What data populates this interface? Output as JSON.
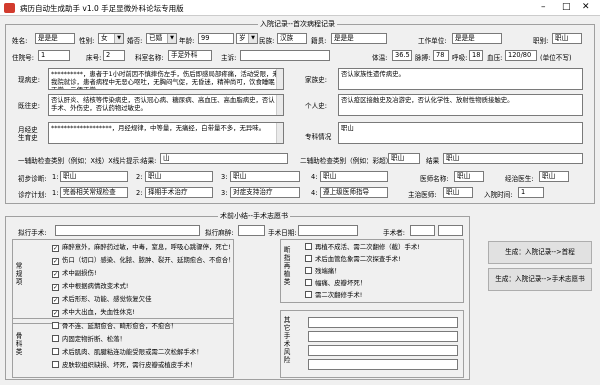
{
  "window": {
    "title": "病历自动生成助手 v1.0 手足显微外科论坛专用版",
    "min": "–",
    "max": "□",
    "close": "✕"
  },
  "group1_title": "入院记录--首次病程记录",
  "row1": {
    "name_label": "姓名:",
    "name_value": "是是是",
    "sex_label": "性别:",
    "sex_value": "女",
    "marital_label": "婚否:",
    "marital_value": "已婚",
    "age_label": "年龄:",
    "age_value": "99",
    "age_unit_label": "岁",
    "age_unit_value": "岁",
    "nation_label": "民族:",
    "nation_value": "汉族",
    "origin_label": "籍贯:",
    "origin_value": "是是是",
    "work_label": "工作单位:",
    "work_value": "是是是",
    "job_label": "职别:",
    "job_value": "职山"
  },
  "row2": {
    "bed_label": "住院号:",
    "bed_value": "1",
    "bedno_label": "床号:",
    "bedno_value": "2",
    "dept_label": "科室名称:",
    "dept_value": "手足外科",
    "chief_label": "主诉:",
    "temp_label": "体温:",
    "temp_value": "36.5",
    "pulse_label": "脉搏:",
    "pulse_value": "78",
    "resp_label": "呼吸:",
    "resp_value": "18",
    "bp_label": "血压:",
    "bp_value": "120/80",
    "bp_unit": "(单位不写)"
  },
  "history": {
    "present_label": "现病史:",
    "present_value": "**********，患者于1小时前因不慎摔伤左手，伤后即感局部疼痛，活动受限，来我院就诊，患者病程中无恶心呕吐，无胸闷气促，无昏迷，精神尚可，饮食睡眠正常，二便正常。",
    "family_label": "家族史:",
    "family_value": "否认家族性遗传病史。",
    "past_label": "既往史:",
    "past_value": "否认肝炎、结核等传染病史，否认冠心病、糖尿病、高血压、高血脂病史，否认手术、外伤史，否认药物过敏史。",
    "personal_label": "个人史:",
    "personal_value": "否认疫区接触史及冶游史，否认化学性、放射性物质接触史。",
    "exam_label": "月经史\n生育史",
    "exam_value": "*******************，月经规律，中等量，无痛经，白带量不多，无异味。",
    "special_label": "专科情况",
    "special_value": "职山"
  },
  "aux": {
    "first_label": "一辅助检查类别（例如：X线）X线片提示:",
    "first_value": "结果:",
    "first_result": "山",
    "second_label": "二辅助检查类别（例如：彩超）",
    "second_value": "职山",
    "second_result_label": "结果",
    "second_result": "职山"
  },
  "diag": {
    "init_label": "初步诊断:",
    "d1": "1:",
    "d1v": "职山",
    "d2": "2:",
    "d2v": "职山",
    "d3": "3:",
    "d3v": "职山",
    "d4": "4:",
    "d4v": "职山",
    "doctor_label": "医师名称:",
    "doctor_value": "职山",
    "attending_label": "经治医生:",
    "attending_value": "职山"
  },
  "plan": {
    "label": "诊疗计划:",
    "p1": "1:",
    "p1v": "完善相关常规检查",
    "p2": "2:",
    "p2v": "择期手术治疗",
    "p3": "3:",
    "p3v": "对症支持治疗",
    "p4": "4:",
    "p4v": "遵上级医师指导",
    "chief_doc_label": "主治医师:",
    "chief_doc_value": "职山",
    "date_label": "入院时间:",
    "date_value": "1"
  },
  "group2_title": "术前小结--手术志愿书",
  "surgery": {
    "name_label": "拟行手术:",
    "name_value": "",
    "anes_label": "拟行麻醉:",
    "anes_value": "",
    "date_label": "手术日期:",
    "date_value": "",
    "doctor_label": "手术者:",
    "doctor_value": ""
  },
  "left_checks_label": "常规项",
  "left_checks": [
    {
      "label": "麻醉意外，麻醉药过敏，中毒，窒息，呼吸心跳骤停，死亡!",
      "checked": true
    },
    {
      "label": "伤口（切口）感染、化脓、脓肿、裂开、延期愈合、不愈合！",
      "checked": true
    },
    {
      "label": "术中副损伤!",
      "checked": true
    },
    {
      "label": "术中根据病情改变术式!",
      "checked": true
    },
    {
      "label": "术后形形、功能、感觉恢复欠佳",
      "checked": true
    },
    {
      "label": "术中大出血，失血性休克!",
      "checked": true
    }
  ],
  "left2_checks_label": "骨科类",
  "left2_checks": [
    {
      "label": "骨不连、延期愈合、畸形愈合，不愈合！",
      "checked": false
    },
    {
      "label": "内固定物折断、松落！",
      "checked": false
    },
    {
      "label": "术后肌肉、肌腱粘连功能受限或需二次松解手术！",
      "checked": false
    },
    {
      "label": "皮肤软组织缺损、坏死，需行皮瓣或植皮手术！",
      "checked": false
    }
  ],
  "right_checks_label": "断指再植类",
  "right_checks": [
    {
      "label": "再植不成活、需二次翻修（截）手术!",
      "checked": false
    },
    {
      "label": "术后血管危象需二次探查手术!",
      "checked": false
    },
    {
      "label": "残端痛！",
      "checked": false
    },
    {
      "label": "幅痛、皮瓣坏死！",
      "checked": false
    },
    {
      "label": "需二次翻修手术!",
      "checked": false
    }
  ],
  "right2_label": "其它手术风险",
  "buttons": {
    "gen1": "生成：入院记录-->首程",
    "gen2": "生成：入院记录-->手术志愿书"
  }
}
